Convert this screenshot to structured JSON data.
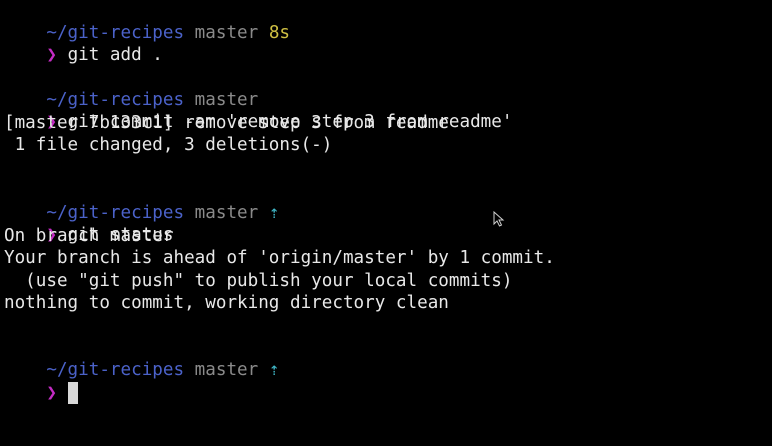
{
  "colors": {
    "background": "#000000",
    "path": "#4b62c9",
    "branch": "#8a8a8a",
    "duration": "#cfc043",
    "ahead_arrow": "#3fb6c6",
    "prompt": "#c42cc4",
    "text": "#e8e8e8"
  },
  "blocks": [
    {
      "path": "~/git-recipes",
      "branch": "master",
      "duration": "8s",
      "prompt": "❯",
      "command": "git add ."
    },
    {
      "path": "~/git-recipes",
      "branch": "master",
      "prompt": "❯",
      "command": "git commit -am 'remove step 3 from readme'",
      "output": [
        "[master 7b133c1] remove step 3 from readme",
        " 1 file changed, 3 deletions(-)"
      ]
    },
    {
      "path": "~/git-recipes",
      "branch": "master",
      "ahead": "⇡",
      "prompt": "❯",
      "command": "git status",
      "output": [
        "On branch master",
        "Your branch is ahead of 'origin/master' by 1 commit.",
        "  (use \"git push\" to publish your local commits)",
        "nothing to commit, working directory clean"
      ]
    },
    {
      "path": "~/git-recipes",
      "branch": "master",
      "ahead": "⇡",
      "prompt": "❯",
      "command": ""
    }
  ],
  "icons": {
    "mouse_pointer": "mouse-pointer-icon",
    "cursor": "text-cursor"
  }
}
